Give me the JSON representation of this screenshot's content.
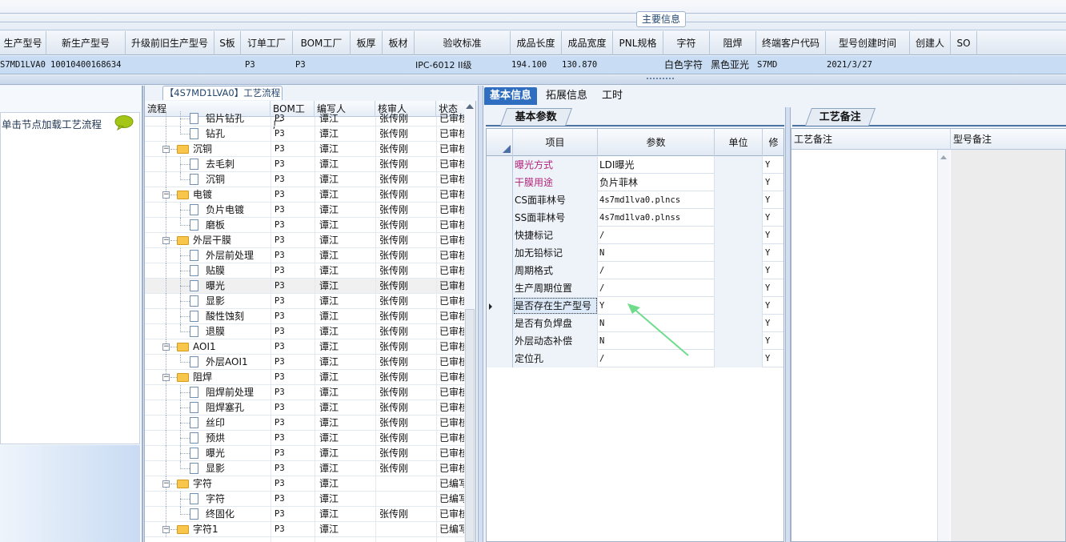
{
  "main_info_label": "主要信息",
  "header_columns": [
    "生产型号",
    "新生产型号",
    "升级前旧生产型号",
    "S板",
    "订单工厂",
    "BOM工厂",
    "板厚",
    "板材",
    "验收标准",
    "成品长度",
    "成品宽度",
    "PNL规格",
    "字符",
    "阻焊",
    "终端客户代码",
    "型号创建时间",
    "创建人",
    "SO"
  ],
  "data_row": {
    "model": "S7MD1LVA0",
    "new_model": "10010400168634",
    "order_factory": "P3",
    "bom_factory": "P3",
    "acceptance": "IPC-6012 II级",
    "length": "194.100",
    "width": "130.870",
    "char": "白色字符",
    "solder_mask": "黑色亚光",
    "customer_code": "S7MD",
    "created": "2021/3/27"
  },
  "left_panel": {
    "hint": "单击节点加载工艺流程"
  },
  "process_tab": "【4S7MD1LVA0】工艺流程",
  "tree": {
    "headers": [
      "流程",
      "BOM工厂",
      "编写人",
      "核审人",
      "状态"
    ],
    "rows": [
      {
        "level": 1,
        "name": "铝片钻孔",
        "bom": "P3",
        "writer": "谭江",
        "reviewer": "张传刚",
        "status": "已审核"
      },
      {
        "level": 1,
        "name": "钻孔",
        "bom": "P3",
        "writer": "谭江",
        "reviewer": "张传刚",
        "status": "已审核"
      },
      {
        "level": 0,
        "name": "沉铜",
        "bom": "P3",
        "writer": "谭江",
        "reviewer": "张传刚",
        "status": "已审核"
      },
      {
        "level": 1,
        "name": "去毛刺",
        "bom": "P3",
        "writer": "谭江",
        "reviewer": "张传刚",
        "status": "已审核"
      },
      {
        "level": 1,
        "name": "沉铜",
        "bom": "P3",
        "writer": "谭江",
        "reviewer": "张传刚",
        "status": "已审核"
      },
      {
        "level": 0,
        "name": "电镀",
        "bom": "P3",
        "writer": "谭江",
        "reviewer": "张传刚",
        "status": "已审核"
      },
      {
        "level": 1,
        "name": "负片电镀",
        "bom": "P3",
        "writer": "谭江",
        "reviewer": "张传刚",
        "status": "已审核"
      },
      {
        "level": 1,
        "name": "磨板",
        "bom": "P3",
        "writer": "谭江",
        "reviewer": "张传刚",
        "status": "已审核"
      },
      {
        "level": 0,
        "name": "外层干膜",
        "bom": "P3",
        "writer": "谭江",
        "reviewer": "张传刚",
        "status": "已审核"
      },
      {
        "level": 1,
        "name": "外层前处理",
        "bom": "P3",
        "writer": "谭江",
        "reviewer": "张传刚",
        "status": "已审核"
      },
      {
        "level": 1,
        "name": "贴膜",
        "bom": "P3",
        "writer": "谭江",
        "reviewer": "张传刚",
        "status": "已审核"
      },
      {
        "level": 1,
        "name": "曝光",
        "bom": "P3",
        "writer": "谭江",
        "reviewer": "张传刚",
        "status": "已审核",
        "selected": true
      },
      {
        "level": 1,
        "name": "显影",
        "bom": "P3",
        "writer": "谭江",
        "reviewer": "张传刚",
        "status": "已审核"
      },
      {
        "level": 1,
        "name": "酸性蚀刻",
        "bom": "P3",
        "writer": "谭江",
        "reviewer": "张传刚",
        "status": "已审核"
      },
      {
        "level": 1,
        "name": "退膜",
        "bom": "P3",
        "writer": "谭江",
        "reviewer": "张传刚",
        "status": "已审核"
      },
      {
        "level": 0,
        "name": "AOI1",
        "bom": "P3",
        "writer": "谭江",
        "reviewer": "张传刚",
        "status": "已审核"
      },
      {
        "level": 1,
        "name": "外层AOI1",
        "bom": "P3",
        "writer": "谭江",
        "reviewer": "张传刚",
        "status": "已审核"
      },
      {
        "level": 0,
        "name": "阻焊",
        "bom": "P3",
        "writer": "谭江",
        "reviewer": "张传刚",
        "status": "已审核"
      },
      {
        "level": 1,
        "name": "阻焊前处理",
        "bom": "P3",
        "writer": "谭江",
        "reviewer": "张传刚",
        "status": "已审核"
      },
      {
        "level": 1,
        "name": "阻焊塞孔",
        "bom": "P3",
        "writer": "谭江",
        "reviewer": "张传刚",
        "status": "已审核"
      },
      {
        "level": 1,
        "name": "丝印",
        "bom": "P3",
        "writer": "谭江",
        "reviewer": "张传刚",
        "status": "已审核"
      },
      {
        "level": 1,
        "name": "预烘",
        "bom": "P3",
        "writer": "谭江",
        "reviewer": "张传刚",
        "status": "已审核"
      },
      {
        "level": 1,
        "name": "曝光",
        "bom": "P3",
        "writer": "谭江",
        "reviewer": "张传刚",
        "status": "已审核"
      },
      {
        "level": 1,
        "name": "显影",
        "bom": "P3",
        "writer": "谭江",
        "reviewer": "张传刚",
        "status": "已审核"
      },
      {
        "level": 0,
        "name": "字符",
        "bom": "P3",
        "writer": "谭江",
        "reviewer": "",
        "status": "已编写"
      },
      {
        "level": 1,
        "name": "字符",
        "bom": "P3",
        "writer": "谭江",
        "reviewer": "",
        "status": "已编写"
      },
      {
        "level": 1,
        "name": "终固化",
        "bom": "P3",
        "writer": "谭江",
        "reviewer": "张传刚",
        "status": "已审核"
      },
      {
        "level": 0,
        "name": "字符1",
        "bom": "P3",
        "writer": "谭江",
        "reviewer": "",
        "status": "已编写"
      }
    ]
  },
  "right_tabs": [
    "基本信息",
    "拓展信息",
    "工时"
  ],
  "subtab_basic": "基本参数",
  "subtab_remark": "工艺备注",
  "params": {
    "headers": [
      "项目",
      "参数",
      "单位",
      "修"
    ],
    "rows": [
      {
        "item": "曝光方式",
        "value": "LDI曝光",
        "unit": "",
        "flag": "Y",
        "pink": true
      },
      {
        "item": "干膜用途",
        "value": "负片菲林",
        "unit": "",
        "flag": "Y",
        "pink": true
      },
      {
        "item": "CS面菲林号",
        "value": "4s7md1lva0.plncs",
        "unit": "",
        "flag": "Y"
      },
      {
        "item": "SS面菲林号",
        "value": "4s7md1lva0.plnss",
        "unit": "",
        "flag": "Y"
      },
      {
        "item": "快捷标记",
        "value": "/",
        "unit": "",
        "flag": "Y"
      },
      {
        "item": "加无铅标记",
        "value": "N",
        "unit": "",
        "flag": "Y"
      },
      {
        "item": "周期格式",
        "value": "/",
        "unit": "",
        "flag": "Y"
      },
      {
        "item": "生产周期位置",
        "value": "/",
        "unit": "",
        "flag": "Y"
      },
      {
        "item": "是否存在生产型号",
        "value": "Y",
        "unit": "",
        "flag": "Y",
        "current": true
      },
      {
        "item": "是否有负焊盘",
        "value": "N",
        "unit": "",
        "flag": "Y"
      },
      {
        "item": "外层动态补偿",
        "value": "N",
        "unit": "",
        "flag": "Y"
      },
      {
        "item": "定位孔",
        "value": "/",
        "unit": "",
        "flag": "Y"
      }
    ]
  },
  "remarks_headers": [
    "工艺备注",
    "型号备注"
  ],
  "colors": {
    "accent": "#2e6dc0",
    "selected_row": "#c8dcf4",
    "pink_label": "#b1257a",
    "arrow": "#6fdc8c"
  }
}
